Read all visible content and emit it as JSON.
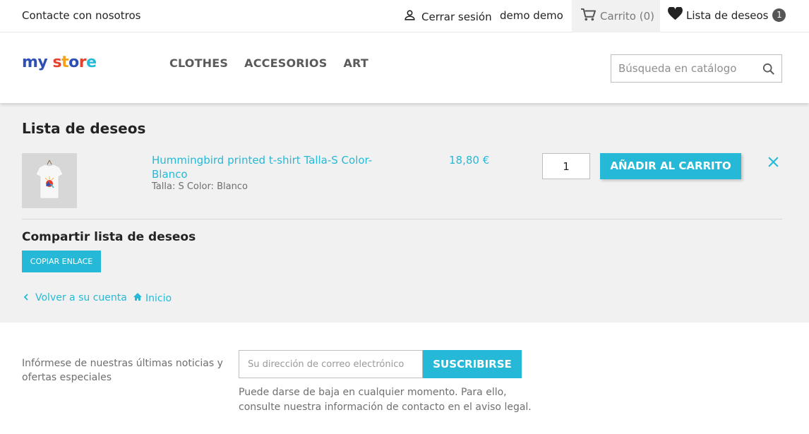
{
  "topbar": {
    "contact": "Contacte con nosotros",
    "logout": "Cerrar sesión",
    "username": "demo demo",
    "cart": "Carrito (0)",
    "wishlist": "Lista de deseos",
    "wishlist_count": "1"
  },
  "header": {
    "logo_word1": "my",
    "logo_word2": "store",
    "nav": [
      "CLOTHES",
      "ACCESORIOS",
      "ART"
    ],
    "search_placeholder": "Búsqueda en catálogo"
  },
  "main": {
    "title": "Lista de deseos",
    "item": {
      "name": "Hummingbird printed t-shirt Talla-S Color-Blanco",
      "attributes": "Talla: S Color: Blanco",
      "price": "18,80 €",
      "quantity": "1",
      "add_label": "AÑADIR AL CARRITO"
    },
    "share_title": "Compartir lista de deseos",
    "copy_label": "COPIAR ENLACE",
    "back_label": "Volver a su cuenta",
    "home_label": "Inicio"
  },
  "newsletter": {
    "text": "Infórmese de nuestras últimas noticias y ofertas especiales",
    "placeholder": "Su dirección de correo electrónico",
    "button": "SUSCRIBIRSE",
    "note": "Puede darse de baja en cualquier momento. Para ello, consulte nuestra información de contacto en el aviso legal."
  },
  "colors": {
    "accent": "#25b9d7",
    "panel_bg": "#f1f1f1",
    "text": "#232323"
  },
  "icons": [
    "user-icon",
    "cart-icon",
    "heart-icon",
    "search-icon",
    "close-icon",
    "chevron-left-icon",
    "home-icon"
  ]
}
